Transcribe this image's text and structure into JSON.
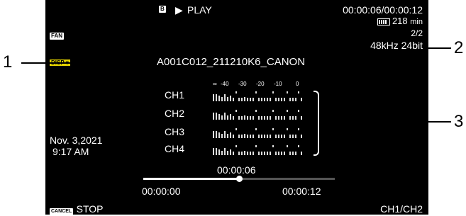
{
  "header": {
    "media_badge": "B",
    "play_icon": "play-icon",
    "mode": "PLAY",
    "timecode": "00:00:06/00:00:12",
    "battery_icon": "battery-icon",
    "remaining": "218",
    "remaining_unit": "min",
    "clip_index": "2/2",
    "audio_format": "48kHz 24bit"
  },
  "left": {
    "fan_tag": "FAN",
    "disp_tag": "DISP",
    "date": "Nov. 3,2021",
    "time": "9:17 AM"
  },
  "clip_name": "A001C012_211210K6_CANON",
  "meter": {
    "scale": [
      "∞",
      "-40",
      "-30",
      "-20",
      "-10",
      "0"
    ],
    "channels": [
      "CH1",
      "CH2",
      "CH3",
      "CH4"
    ]
  },
  "playback": {
    "current": "00:00:06",
    "start": "00:00:00",
    "end": "00:00:12",
    "progress": 0.5
  },
  "footer": {
    "cancel_tag": "CANCEL",
    "stop_label": "STOP",
    "channel_select": "CH1/CH2"
  },
  "callouts": [
    "1",
    "2",
    "3"
  ]
}
